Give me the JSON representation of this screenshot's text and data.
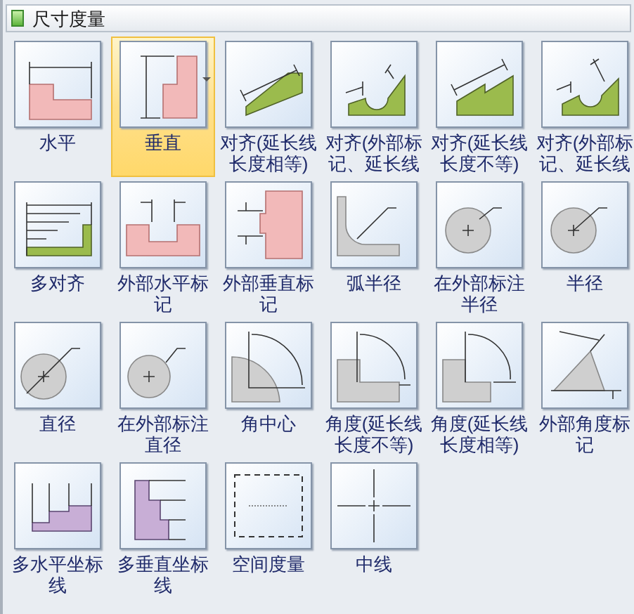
{
  "panel": {
    "title": "尺寸度量"
  },
  "items": [
    {
      "label": "水平",
      "selected": false
    },
    {
      "label": "垂直",
      "selected": true
    },
    {
      "label": "对齐(延长线长度相等)",
      "selected": false
    },
    {
      "label": "对齐(外部标记、延长线",
      "selected": false
    },
    {
      "label": "对齐(延长线长度不等)",
      "selected": false
    },
    {
      "label": "对齐(外部标记、延长线",
      "selected": false
    },
    {
      "label": "多对齐",
      "selected": false
    },
    {
      "label": "外部水平标记",
      "selected": false
    },
    {
      "label": "外部垂直标记",
      "selected": false
    },
    {
      "label": "弧半径",
      "selected": false
    },
    {
      "label": "在外部标注半径",
      "selected": false
    },
    {
      "label": "半径",
      "selected": false
    },
    {
      "label": "直径",
      "selected": false
    },
    {
      "label": "在外部标注直径",
      "selected": false
    },
    {
      "label": "角中心",
      "selected": false
    },
    {
      "label": "角度(延长线长度不等)",
      "selected": false
    },
    {
      "label": "角度(延长线长度相等)",
      "selected": false
    },
    {
      "label": "外部角度标记",
      "selected": false
    },
    {
      "label": "多水平坐标线",
      "selected": false
    },
    {
      "label": "多垂直坐标线",
      "selected": false
    },
    {
      "label": "空间度量",
      "selected": false
    },
    {
      "label": "中线",
      "selected": false
    }
  ]
}
